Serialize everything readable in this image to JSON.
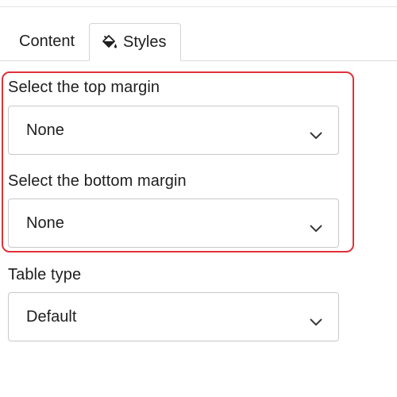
{
  "tabs": {
    "content_label": "Content",
    "styles_label": "Styles",
    "styles_icon": "paint-bucket-icon"
  },
  "top_margin": {
    "label": "Select the top margin",
    "value": "None"
  },
  "bottom_margin": {
    "label": "Select the bottom margin",
    "value": "None"
  },
  "table_type": {
    "label": "Table type",
    "value": "Default"
  },
  "colors": {
    "highlight": "#e0313a",
    "border": "#c8c8c8",
    "text": "#1e1e1e"
  }
}
